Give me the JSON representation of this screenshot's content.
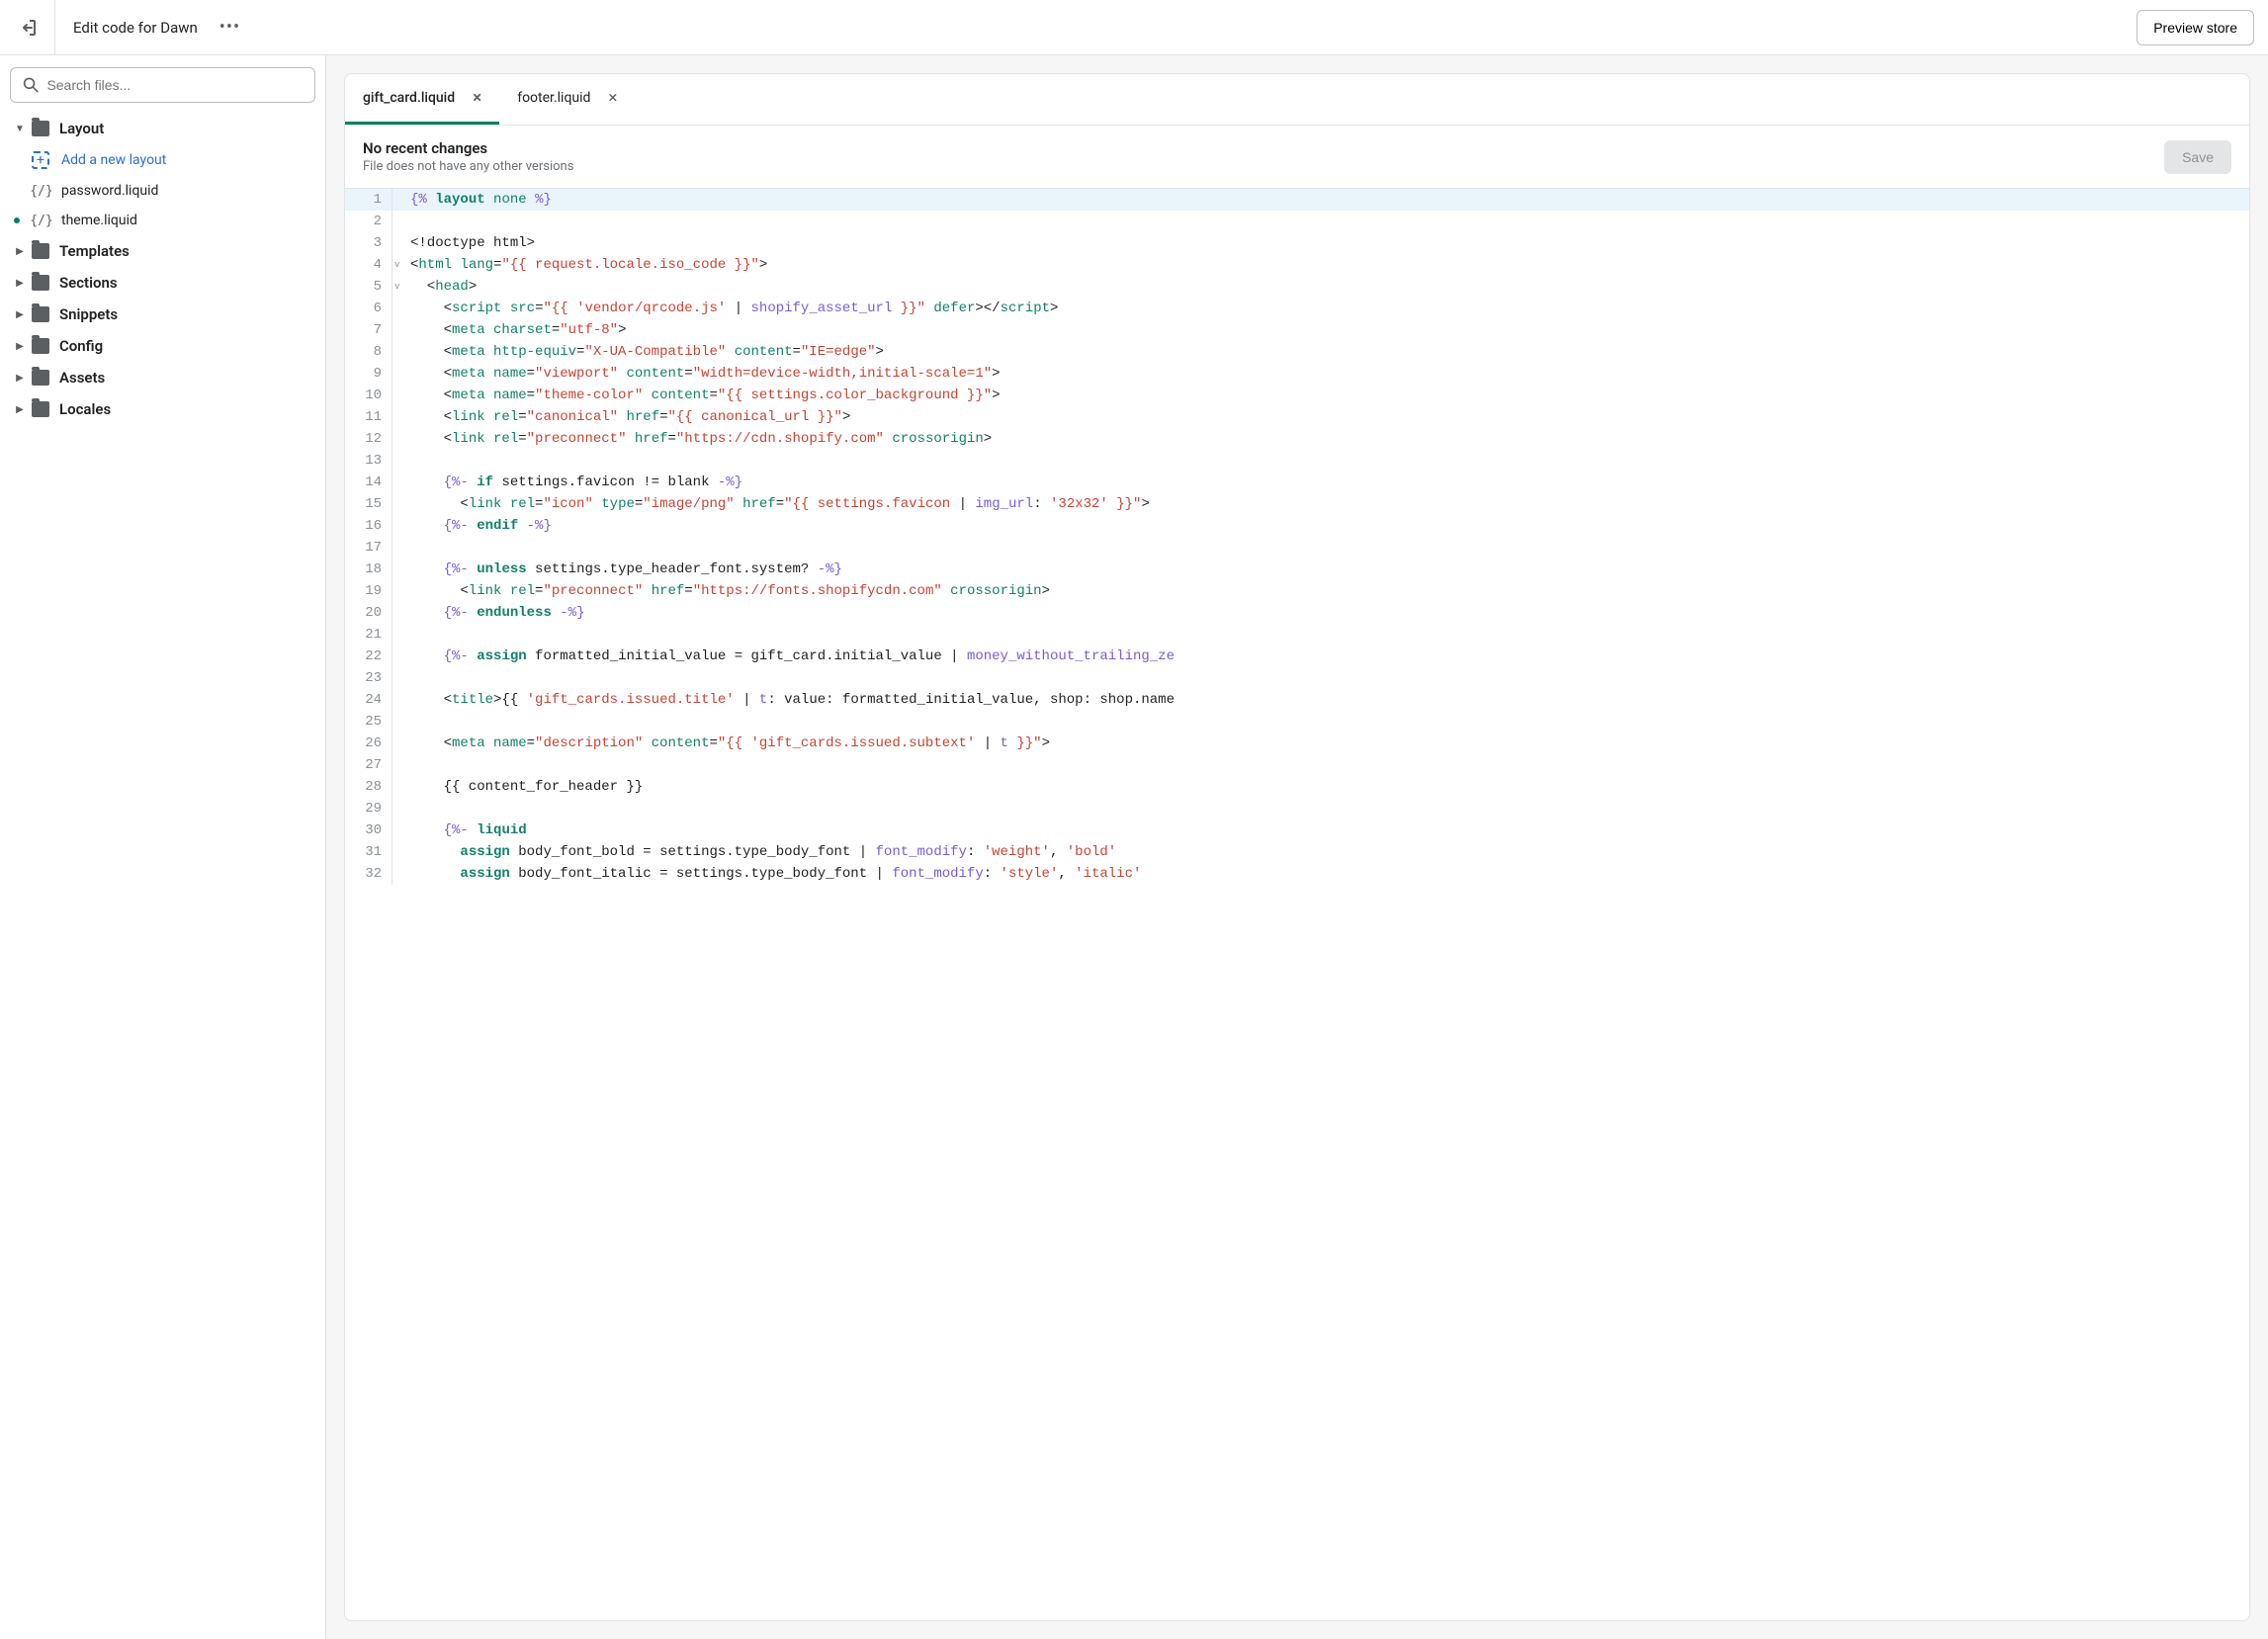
{
  "header": {
    "title": "Edit code for Dawn",
    "preview_button": "Preview store"
  },
  "search": {
    "placeholder": "Search files..."
  },
  "sidebar": {
    "folders": [
      {
        "name": "Layout",
        "expanded": true
      },
      {
        "name": "Templates",
        "expanded": false
      },
      {
        "name": "Sections",
        "expanded": false
      },
      {
        "name": "Snippets",
        "expanded": false
      },
      {
        "name": "Config",
        "expanded": false
      },
      {
        "name": "Assets",
        "expanded": false
      },
      {
        "name": "Locales",
        "expanded": false
      }
    ],
    "layout_files": {
      "add": "Add a new layout",
      "files": [
        "password.liquid",
        "theme.liquid"
      ],
      "modified": "theme.liquid"
    }
  },
  "tabs": [
    {
      "label": "gift_card.liquid",
      "active": true
    },
    {
      "label": "footer.liquid",
      "active": false
    }
  ],
  "info": {
    "title": "No recent changes",
    "subtitle": "File does not have any other versions",
    "save": "Save"
  },
  "code": [
    {
      "n": 1,
      "hl": true,
      "fold": "",
      "tokens": [
        [
          "pct",
          "{%"
        ],
        [
          "ident",
          " "
        ],
        [
          "kw",
          "layout"
        ],
        [
          "ident",
          " "
        ],
        [
          "tag",
          "none"
        ],
        [
          "ident",
          " "
        ],
        [
          "pct",
          "%}"
        ]
      ]
    },
    {
      "n": 2,
      "fold": "",
      "tokens": []
    },
    {
      "n": 3,
      "fold": "",
      "tokens": [
        [
          "ident",
          "<!doctype html>"
        ]
      ]
    },
    {
      "n": 4,
      "fold": "v",
      "tokens": [
        [
          "ident",
          "<"
        ],
        [
          "tag",
          "html"
        ],
        [
          "ident",
          " "
        ],
        [
          "attr",
          "lang"
        ],
        [
          "ident",
          "="
        ],
        [
          "str",
          "\"{{ request.locale.iso_code }}\""
        ],
        [
          "ident",
          ">"
        ]
      ]
    },
    {
      "n": 5,
      "fold": "v",
      "tokens": [
        [
          "ident",
          "  <"
        ],
        [
          "tag",
          "head"
        ],
        [
          "ident",
          ">"
        ]
      ]
    },
    {
      "n": 6,
      "fold": "",
      "tokens": [
        [
          "ident",
          "    <"
        ],
        [
          "tag",
          "script"
        ],
        [
          "ident",
          " "
        ],
        [
          "attr",
          "src"
        ],
        [
          "ident",
          "="
        ],
        [
          "str",
          "\"{{ 'vendor/qrcode.js' "
        ],
        [
          "ident",
          "| "
        ],
        [
          "filter",
          "shopify_asset_url"
        ],
        [
          "str",
          " }}\""
        ],
        [
          "ident",
          " "
        ],
        [
          "attr",
          "defer"
        ],
        [
          "ident",
          "></"
        ],
        [
          "tag",
          "script"
        ],
        [
          "ident",
          ">"
        ]
      ]
    },
    {
      "n": 7,
      "fold": "",
      "tokens": [
        [
          "ident",
          "    <"
        ],
        [
          "tag",
          "meta"
        ],
        [
          "ident",
          " "
        ],
        [
          "attr",
          "charset"
        ],
        [
          "ident",
          "="
        ],
        [
          "str",
          "\"utf-8\""
        ],
        [
          "ident",
          ">"
        ]
      ]
    },
    {
      "n": 8,
      "fold": "",
      "tokens": [
        [
          "ident",
          "    <"
        ],
        [
          "tag",
          "meta"
        ],
        [
          "ident",
          " "
        ],
        [
          "attr",
          "http-equiv"
        ],
        [
          "ident",
          "="
        ],
        [
          "str",
          "\"X-UA-Compatible\""
        ],
        [
          "ident",
          " "
        ],
        [
          "attr",
          "content"
        ],
        [
          "ident",
          "="
        ],
        [
          "str",
          "\"IE=edge\""
        ],
        [
          "ident",
          ">"
        ]
      ]
    },
    {
      "n": 9,
      "fold": "",
      "tokens": [
        [
          "ident",
          "    <"
        ],
        [
          "tag",
          "meta"
        ],
        [
          "ident",
          " "
        ],
        [
          "attr",
          "name"
        ],
        [
          "ident",
          "="
        ],
        [
          "str",
          "\"viewport\""
        ],
        [
          "ident",
          " "
        ],
        [
          "attr",
          "content"
        ],
        [
          "ident",
          "="
        ],
        [
          "str",
          "\"width=device-width,initial-scale=1\""
        ],
        [
          "ident",
          ">"
        ]
      ]
    },
    {
      "n": 10,
      "fold": "",
      "tokens": [
        [
          "ident",
          "    <"
        ],
        [
          "tag",
          "meta"
        ],
        [
          "ident",
          " "
        ],
        [
          "attr",
          "name"
        ],
        [
          "ident",
          "="
        ],
        [
          "str",
          "\"theme-color\""
        ],
        [
          "ident",
          " "
        ],
        [
          "attr",
          "content"
        ],
        [
          "ident",
          "="
        ],
        [
          "str",
          "\"{{ settings.color_background }}\""
        ],
        [
          "ident",
          ">"
        ]
      ]
    },
    {
      "n": 11,
      "fold": "",
      "tokens": [
        [
          "ident",
          "    <"
        ],
        [
          "tag",
          "link"
        ],
        [
          "ident",
          " "
        ],
        [
          "attr",
          "rel"
        ],
        [
          "ident",
          "="
        ],
        [
          "str",
          "\"canonical\""
        ],
        [
          "ident",
          " "
        ],
        [
          "attr",
          "href"
        ],
        [
          "ident",
          "="
        ],
        [
          "str",
          "\"{{ canonical_url }}\""
        ],
        [
          "ident",
          ">"
        ]
      ]
    },
    {
      "n": 12,
      "fold": "",
      "tokens": [
        [
          "ident",
          "    <"
        ],
        [
          "tag",
          "link"
        ],
        [
          "ident",
          " "
        ],
        [
          "attr",
          "rel"
        ],
        [
          "ident",
          "="
        ],
        [
          "str",
          "\"preconnect\""
        ],
        [
          "ident",
          " "
        ],
        [
          "attr",
          "href"
        ],
        [
          "ident",
          "="
        ],
        [
          "str",
          "\"https://cdn.shopify.com\""
        ],
        [
          "ident",
          " "
        ],
        [
          "attr",
          "crossorigin"
        ],
        [
          "ident",
          ">"
        ]
      ]
    },
    {
      "n": 13,
      "fold": "",
      "tokens": []
    },
    {
      "n": 14,
      "fold": "",
      "tokens": [
        [
          "ident",
          "    "
        ],
        [
          "pct",
          "{%-"
        ],
        [
          "ident",
          " "
        ],
        [
          "kw",
          "if"
        ],
        [
          "ident",
          " settings.favicon != blank "
        ],
        [
          "pct",
          "-%}"
        ]
      ]
    },
    {
      "n": 15,
      "fold": "",
      "tokens": [
        [
          "ident",
          "      <"
        ],
        [
          "tag",
          "link"
        ],
        [
          "ident",
          " "
        ],
        [
          "attr",
          "rel"
        ],
        [
          "ident",
          "="
        ],
        [
          "str",
          "\"icon\""
        ],
        [
          "ident",
          " "
        ],
        [
          "attr",
          "type"
        ],
        [
          "ident",
          "="
        ],
        [
          "str",
          "\"image/png\""
        ],
        [
          "ident",
          " "
        ],
        [
          "attr",
          "href"
        ],
        [
          "ident",
          "="
        ],
        [
          "str",
          "\"{{ settings.favicon "
        ],
        [
          "ident",
          "| "
        ],
        [
          "filter",
          "img_url"
        ],
        [
          "ident",
          ": "
        ],
        [
          "str",
          "'32x32'"
        ],
        [
          "str",
          " }}\""
        ],
        [
          "ident",
          ">"
        ]
      ]
    },
    {
      "n": 16,
      "fold": "",
      "tokens": [
        [
          "ident",
          "    "
        ],
        [
          "pct",
          "{%-"
        ],
        [
          "ident",
          " "
        ],
        [
          "kw",
          "endif"
        ],
        [
          "ident",
          " "
        ],
        [
          "pct",
          "-%}"
        ]
      ]
    },
    {
      "n": 17,
      "fold": "",
      "tokens": []
    },
    {
      "n": 18,
      "fold": "",
      "tokens": [
        [
          "ident",
          "    "
        ],
        [
          "pct",
          "{%-"
        ],
        [
          "ident",
          " "
        ],
        [
          "kw",
          "unless"
        ],
        [
          "ident",
          " settings.type_header_font.system? "
        ],
        [
          "pct",
          "-%}"
        ]
      ]
    },
    {
      "n": 19,
      "fold": "",
      "tokens": [
        [
          "ident",
          "      <"
        ],
        [
          "tag",
          "link"
        ],
        [
          "ident",
          " "
        ],
        [
          "attr",
          "rel"
        ],
        [
          "ident",
          "="
        ],
        [
          "str",
          "\"preconnect\""
        ],
        [
          "ident",
          " "
        ],
        [
          "attr",
          "href"
        ],
        [
          "ident",
          "="
        ],
        [
          "str",
          "\"https://fonts.shopifycdn.com\""
        ],
        [
          "ident",
          " "
        ],
        [
          "attr",
          "crossorigin"
        ],
        [
          "ident",
          ">"
        ]
      ]
    },
    {
      "n": 20,
      "fold": "",
      "tokens": [
        [
          "ident",
          "    "
        ],
        [
          "pct",
          "{%-"
        ],
        [
          "ident",
          " "
        ],
        [
          "kw",
          "endunless"
        ],
        [
          "ident",
          " "
        ],
        [
          "pct",
          "-%}"
        ]
      ]
    },
    {
      "n": 21,
      "fold": "",
      "tokens": []
    },
    {
      "n": 22,
      "fold": "",
      "tokens": [
        [
          "ident",
          "    "
        ],
        [
          "pct",
          "{%-"
        ],
        [
          "ident",
          " "
        ],
        [
          "kw",
          "assign"
        ],
        [
          "ident",
          " formatted_initial_value = gift_card.initial_value | "
        ],
        [
          "filter",
          "money_without_trailing_ze"
        ]
      ]
    },
    {
      "n": 23,
      "fold": "",
      "tokens": []
    },
    {
      "n": 24,
      "fold": "",
      "tokens": [
        [
          "ident",
          "    <"
        ],
        [
          "tag",
          "title"
        ],
        [
          "ident",
          ">{{ "
        ],
        [
          "str",
          "'gift_cards.issued.title'"
        ],
        [
          "ident",
          " | "
        ],
        [
          "filter",
          "t"
        ],
        [
          "ident",
          ": value: formatted_initial_value, shop: shop.name"
        ]
      ]
    },
    {
      "n": 25,
      "fold": "",
      "tokens": []
    },
    {
      "n": 26,
      "fold": "",
      "tokens": [
        [
          "ident",
          "    <"
        ],
        [
          "tag",
          "meta"
        ],
        [
          "ident",
          " "
        ],
        [
          "attr",
          "name"
        ],
        [
          "ident",
          "="
        ],
        [
          "str",
          "\"description\""
        ],
        [
          "ident",
          " "
        ],
        [
          "attr",
          "content"
        ],
        [
          "ident",
          "="
        ],
        [
          "str",
          "\"{{ 'gift_cards.issued.subtext' "
        ],
        [
          "ident",
          "| "
        ],
        [
          "filter",
          "t"
        ],
        [
          "str",
          " }}\""
        ],
        [
          "ident",
          ">"
        ]
      ]
    },
    {
      "n": 27,
      "fold": "",
      "tokens": []
    },
    {
      "n": 28,
      "fold": "",
      "tokens": [
        [
          "ident",
          "    {{ content_for_header }}"
        ]
      ]
    },
    {
      "n": 29,
      "fold": "",
      "tokens": []
    },
    {
      "n": 30,
      "fold": "",
      "tokens": [
        [
          "ident",
          "    "
        ],
        [
          "pct",
          "{%-"
        ],
        [
          "ident",
          " "
        ],
        [
          "kw",
          "liquid"
        ]
      ]
    },
    {
      "n": 31,
      "fold": "",
      "tokens": [
        [
          "ident",
          "      "
        ],
        [
          "kw",
          "assign"
        ],
        [
          "ident",
          " body_font_bold = settings.type_body_font | "
        ],
        [
          "filter",
          "font_modify"
        ],
        [
          "ident",
          ": "
        ],
        [
          "str",
          "'weight'"
        ],
        [
          "ident",
          ", "
        ],
        [
          "str",
          "'bold'"
        ]
      ]
    },
    {
      "n": 32,
      "fold": "",
      "tokens": [
        [
          "ident",
          "      "
        ],
        [
          "kw",
          "assign"
        ],
        [
          "ident",
          " body_font_italic = settings.type_body_font | "
        ],
        [
          "filter",
          "font_modify"
        ],
        [
          "ident",
          ": "
        ],
        [
          "str",
          "'style'"
        ],
        [
          "ident",
          ", "
        ],
        [
          "str",
          "'italic'"
        ]
      ]
    }
  ]
}
